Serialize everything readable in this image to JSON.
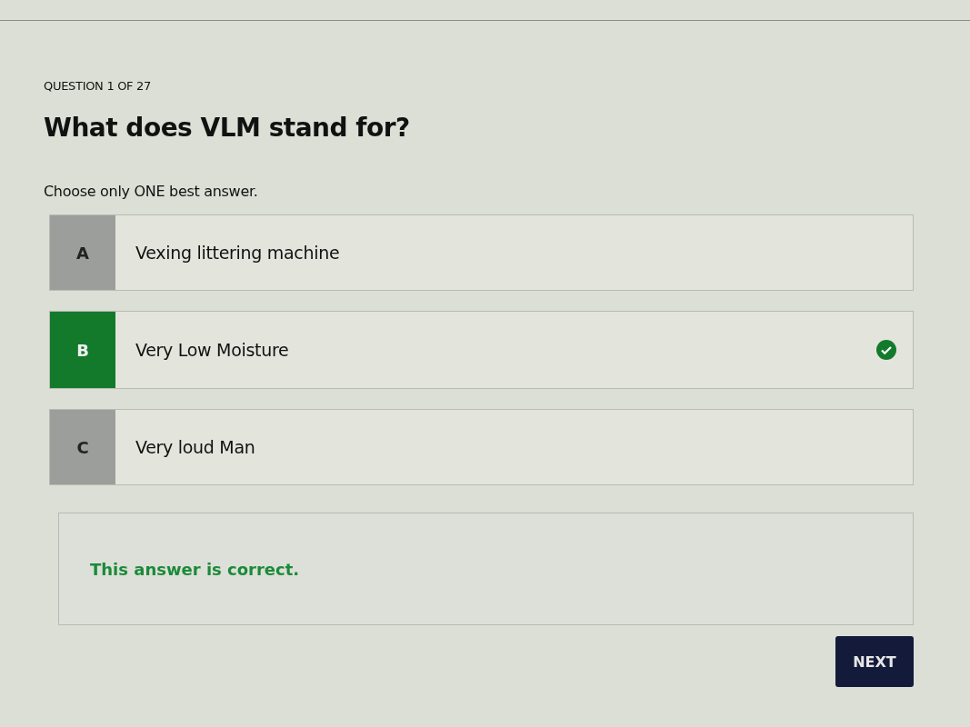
{
  "quiz": {
    "progress": "QUESTION 1 OF 27",
    "question": "What does VLM stand for?",
    "instruction": "Choose only ONE best answer.",
    "options": [
      {
        "letter": "A",
        "text": "Vexing littering machine",
        "selected": false
      },
      {
        "letter": "B",
        "text": "Very Low Moisture",
        "selected": true
      },
      {
        "letter": "C",
        "text": "Very loud Man",
        "selected": false
      }
    ],
    "feedback": {
      "text": "This answer is correct.",
      "correct": true
    },
    "next_button": "NEXT"
  }
}
